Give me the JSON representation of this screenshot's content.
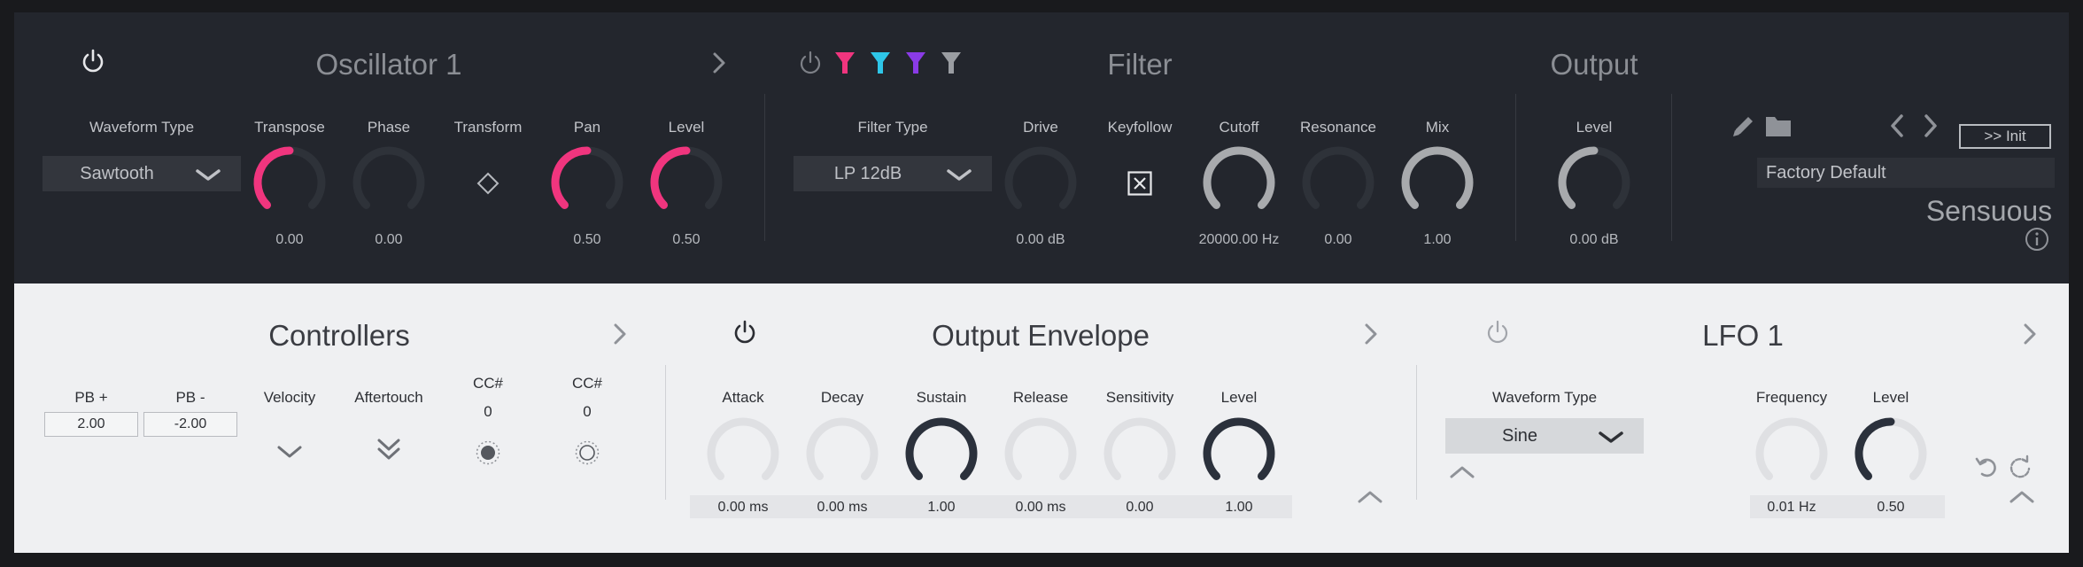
{
  "colors": {
    "top_bg": "#23262d",
    "bottom_bg": "#eff0f2",
    "accent_pink": "#f0357e",
    "filter_cyan": "#2ec6e8",
    "filter_purple": "#8a3be6",
    "knob_light_gray": "#a8aaad",
    "knob_dark_navy": "#2b313c"
  },
  "oscillator": {
    "title": "Oscillator 1",
    "waveform_label": "Waveform Type",
    "waveform_value": "Sawtooth",
    "transpose_label": "Transpose",
    "transpose_value": "0.00",
    "phase_label": "Phase",
    "phase_value": "0.00",
    "transform_label": "Transform",
    "pan_label": "Pan",
    "pan_value": "0.50",
    "level_label": "Level",
    "level_value": "0.50"
  },
  "filter": {
    "title": "Filter",
    "type_label": "Filter Type",
    "type_value": "LP 12dB",
    "drive_label": "Drive",
    "drive_value": "0.00 dB",
    "keyfollow_label": "Keyfollow",
    "cutoff_label": "Cutoff",
    "cutoff_value": "20000.00 Hz",
    "resonance_label": "Resonance",
    "resonance_value": "0.00",
    "mix_label": "Mix",
    "mix_value": "1.00"
  },
  "output": {
    "title": "Output",
    "level_label": "Level",
    "level_value": "0.00 dB"
  },
  "preset": {
    "init_label": ">> Init",
    "bank_name": "Factory Default",
    "patch_name": "Sensuous"
  },
  "controllers": {
    "title": "Controllers",
    "pb_plus_label": "PB +",
    "pb_plus_value": "2.00",
    "pb_minus_label": "PB -",
    "pb_minus_value": "-2.00",
    "velocity_label": "Velocity",
    "aftertouch_label": "Aftertouch",
    "cc1_label": "CC#",
    "cc1_value": "0",
    "cc2_label": "CC#",
    "cc2_value": "0"
  },
  "envelope": {
    "title": "Output Envelope",
    "attack_label": "Attack",
    "attack_value": "0.00 ms",
    "decay_label": "Decay",
    "decay_value": "0.00 ms",
    "sustain_label": "Sustain",
    "sustain_value": "1.00",
    "release_label": "Release",
    "release_value": "0.00 ms",
    "sensitivity_label": "Sensitivity",
    "sensitivity_value": "0.00",
    "level_label": "Level",
    "level_value": "1.00"
  },
  "lfo": {
    "title": "LFO 1",
    "waveform_label": "Waveform Type",
    "waveform_value": "Sine",
    "frequency_label": "Frequency",
    "frequency_value": "0.01 Hz",
    "level_label": "Level",
    "level_value": "0.50"
  },
  "knob_levels": {
    "transpose": 0.5,
    "phase": 0,
    "pan": 0.5,
    "osc_level": 0.5,
    "drive": 0,
    "cutoff": 1,
    "resonance": 0,
    "mix": 1,
    "output_level": 0.5,
    "attack": 0,
    "decay": 0,
    "sustain": 1,
    "release": 0,
    "sensitivity": 0,
    "env_level": 1,
    "lfo_frequency": 0,
    "lfo_level": 0.5
  }
}
